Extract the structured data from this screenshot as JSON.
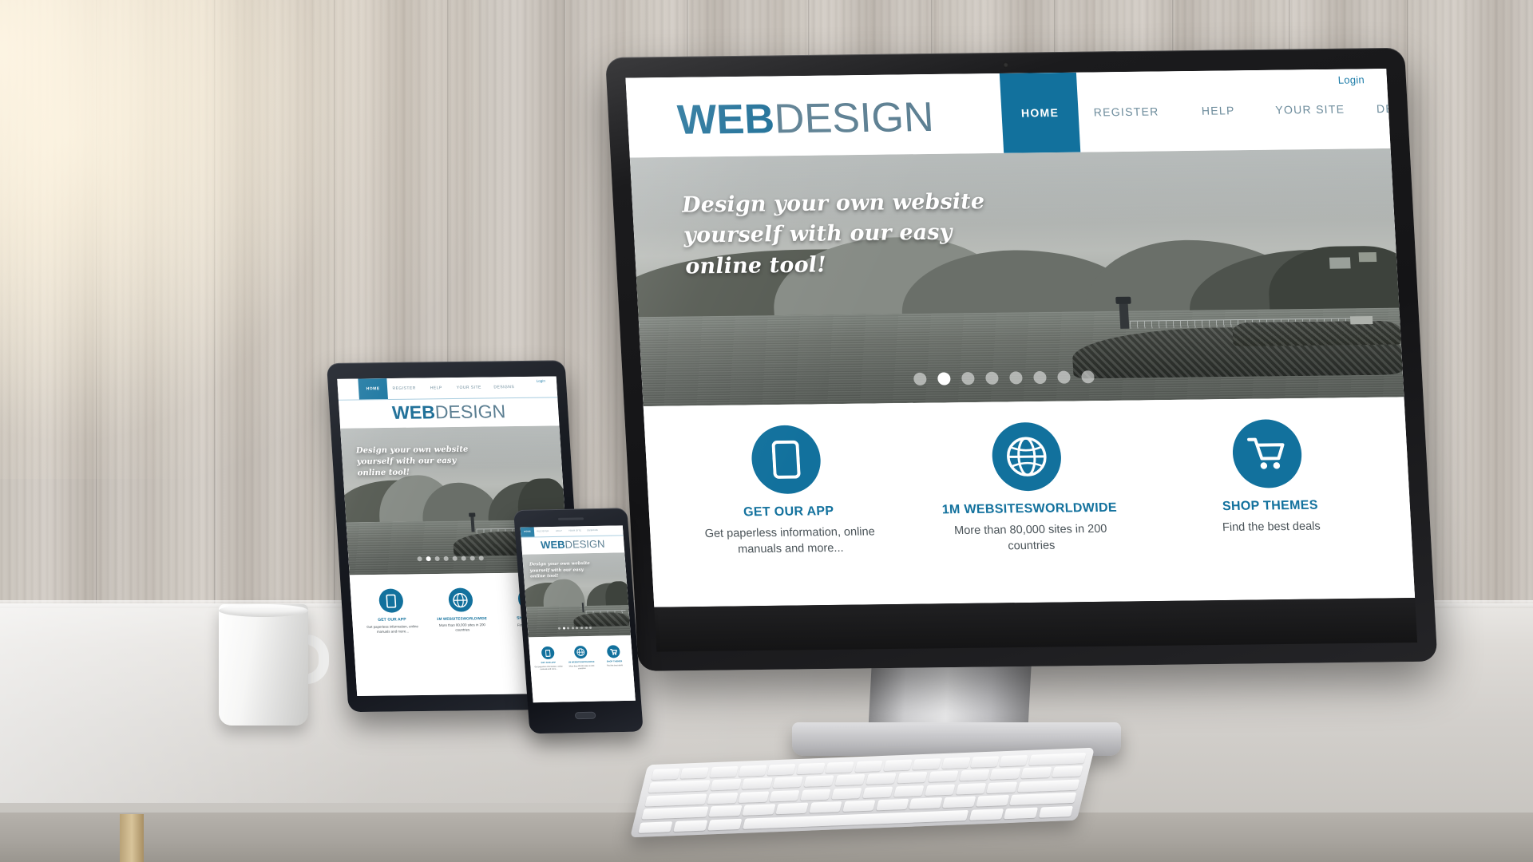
{
  "scene": {
    "title": "Responsive web design mockup on desktop, tablet and smartphone",
    "devices": [
      "desktop-monitor",
      "tablet",
      "smartphone"
    ],
    "props": [
      "coffee-mug",
      "keyboard",
      "wooden-wall",
      "white-desk"
    ]
  },
  "site": {
    "brand": {
      "bold": "WEB",
      "light": "DESIGN"
    },
    "login_label": "Login",
    "nav": [
      {
        "label": "HOME",
        "active": true
      },
      {
        "label": "REGISTER",
        "active": false
      },
      {
        "label": "HELP",
        "active": false
      },
      {
        "label": "YOUR SITE",
        "active": false
      },
      {
        "label": "DESIGNS",
        "active": false
      }
    ],
    "hero": {
      "line1": "Design your own website",
      "line2": "yourself with our easy",
      "line3": "online tool!",
      "slider_dots": 8,
      "slider_active_index": 1
    },
    "features": [
      {
        "icon": "mobile-phone-icon",
        "title": "GET OUR APP",
        "desc": "Get paperless information, online manuals and more..."
      },
      {
        "icon": "globe-icon",
        "title": "1M WEBSITESWORLDWIDE",
        "desc": "More than 80,000 sites in 200 countries"
      },
      {
        "icon": "shopping-cart-icon",
        "title": "SHOP THEMES",
        "desc": "Find the best deals"
      }
    ]
  },
  "colors": {
    "brand_blue": "#12719d",
    "brand_blue_dark": "#1b6d96",
    "nav_text": "#6d8c9c",
    "page_bg": "#ffffff",
    "desk": "#dedbd7",
    "wall": "#c9c3bb"
  }
}
